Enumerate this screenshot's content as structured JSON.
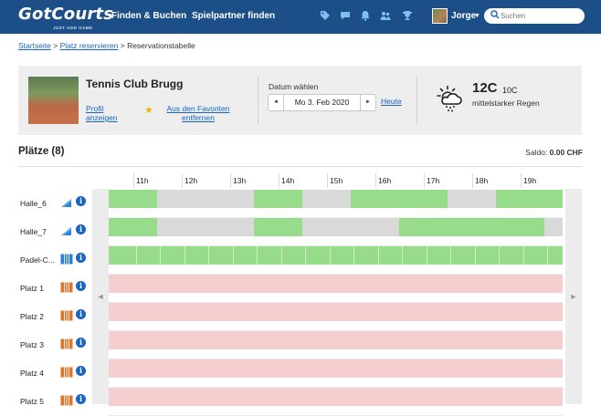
{
  "nav": {
    "logo": "GotCourts",
    "logo_tagline": "JUST ADD GAME",
    "links": [
      "Finden & Buchen",
      "Spielpartner finden"
    ],
    "icons": [
      "tag-icon",
      "chat-icon",
      "bell-icon",
      "users-icon",
      "trophy-icon"
    ],
    "user": "Jorge",
    "search_placeholder": "Suchen"
  },
  "breadcrumb": {
    "home": "Startseite",
    "sep1": " > ",
    "reserve": "Platz reservieren",
    "sep2": " > ",
    "current": "Reservationstabelle"
  },
  "club": {
    "name": "Tennis Club Brugg",
    "profile_link": "Profil anzeigen",
    "favorite_link": "Aus den Favoriten entfernen"
  },
  "date": {
    "label": "Datum wählen",
    "value": "Mo 3. Feb 2020",
    "today": "Heute",
    "prev_label": "◄",
    "next_label": "►"
  },
  "weather": {
    "icon": "rain-cloud-icon",
    "temp_high": "12C",
    "temp_low": "10C",
    "description": "mittelstarker Regen"
  },
  "courts_header": {
    "title": "Plätze (8)",
    "saldo_label": "Saldo: ",
    "saldo_value": "0.00 CHF"
  },
  "timeline": {
    "hours": [
      "11h",
      "12h",
      "13h",
      "14h",
      "15h",
      "16h",
      "17h",
      "18h",
      "19h"
    ],
    "left_arrow": "◄",
    "right_arrow": "►"
  },
  "courts": [
    {
      "name": "Halle_6",
      "surface": "hard-court-icon",
      "slots": [
        "free",
        "booked",
        "booked",
        "free",
        "booked",
        "free",
        "free",
        "booked",
        "free",
        "free"
      ]
    },
    {
      "name": "Halle_7",
      "surface": "hard-court-icon",
      "slots": [
        "free",
        "booked",
        "booked",
        "free",
        "booked",
        "booked",
        "free",
        "free",
        "free",
        "booked"
      ]
    },
    {
      "name": "Padel-C...",
      "surface": "padel-court-icon",
      "slots": [
        "free",
        "free",
        "free",
        "free",
        "free",
        "free",
        "free",
        "free",
        "free",
        "free"
      ],
      "subdivided": true
    },
    {
      "name": "Platz 1",
      "surface": "clay-court-icon",
      "slots": [
        "closed",
        "closed",
        "closed",
        "closed",
        "closed",
        "closed",
        "closed",
        "closed",
        "closed",
        "closed"
      ]
    },
    {
      "name": "Platz 2",
      "surface": "clay-court-icon",
      "slots": [
        "closed",
        "closed",
        "closed",
        "closed",
        "closed",
        "closed",
        "closed",
        "closed",
        "closed",
        "closed"
      ]
    },
    {
      "name": "Platz 3",
      "surface": "clay-court-icon",
      "slots": [
        "closed",
        "closed",
        "closed",
        "closed",
        "closed",
        "closed",
        "closed",
        "closed",
        "closed",
        "closed"
      ]
    },
    {
      "name": "Platz 4",
      "surface": "clay-court-icon",
      "slots": [
        "closed",
        "closed",
        "closed",
        "closed",
        "closed",
        "closed",
        "closed",
        "closed",
        "closed",
        "closed"
      ]
    },
    {
      "name": "Platz 5",
      "surface": "clay-court-icon",
      "slots": [
        "closed",
        "closed",
        "closed",
        "closed",
        "closed",
        "closed",
        "closed",
        "closed",
        "closed",
        "closed"
      ]
    }
  ],
  "colors": {
    "nav_bg": "#1c4f87",
    "link": "#1a64c2",
    "free": "#96dc8a",
    "booked": "#d9d9d9",
    "closed": "#f5cfcf"
  }
}
